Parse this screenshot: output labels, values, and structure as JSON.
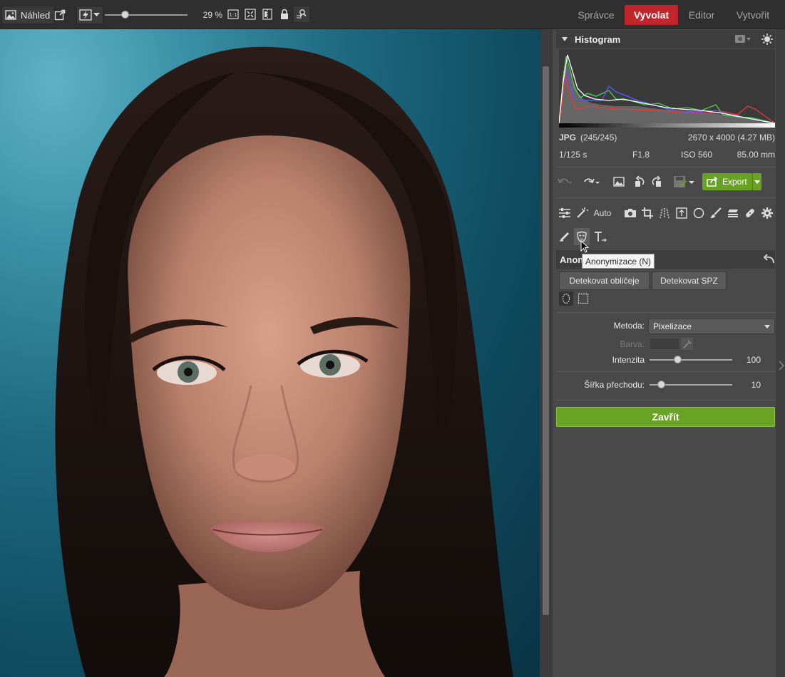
{
  "toolbar": {
    "preview_label": "Náhled",
    "zoom_percent": "29 %",
    "zoom_level": 0.29,
    "icons": [
      "image-icon",
      "external-window-icon",
      "flash-icon",
      "one-to-one-icon",
      "fit-screen-icon",
      "compare-icon",
      "lock-icon",
      "swap-view-icon"
    ]
  },
  "modes": {
    "tabs": [
      "Správce",
      "Vyvolat",
      "Editor",
      "Vytvořit"
    ],
    "active": "Vyvolat",
    "active_color": "#c0262b"
  },
  "histogram": {
    "title": "Histogram",
    "format": "JPG",
    "count": "(245/245)",
    "dimensions": "2670 x 4000 (4.27 MB)",
    "shutter": "1/125 s",
    "aperture": "F1.8",
    "iso": "ISO 560",
    "focal_length": "85.00 mm"
  },
  "actions": {
    "export_label": "Export",
    "export_color": "#6aa224"
  },
  "tools": {
    "auto_label": "Auto"
  },
  "anonymize": {
    "section_title": "Anonymizace",
    "tooltip": "Anonymizace (N)",
    "detect_faces": "Detekovat obličeje",
    "detect_plates": "Detekovat SPZ",
    "method_label": "Metoda:",
    "method_value": "Pixelizace",
    "color_label": "Barva:",
    "intensity_label": "Intenzita",
    "intensity_value": "100",
    "transition_label": "Šířka přechodu:",
    "transition_value": "10",
    "close_label": "Zavřít"
  }
}
